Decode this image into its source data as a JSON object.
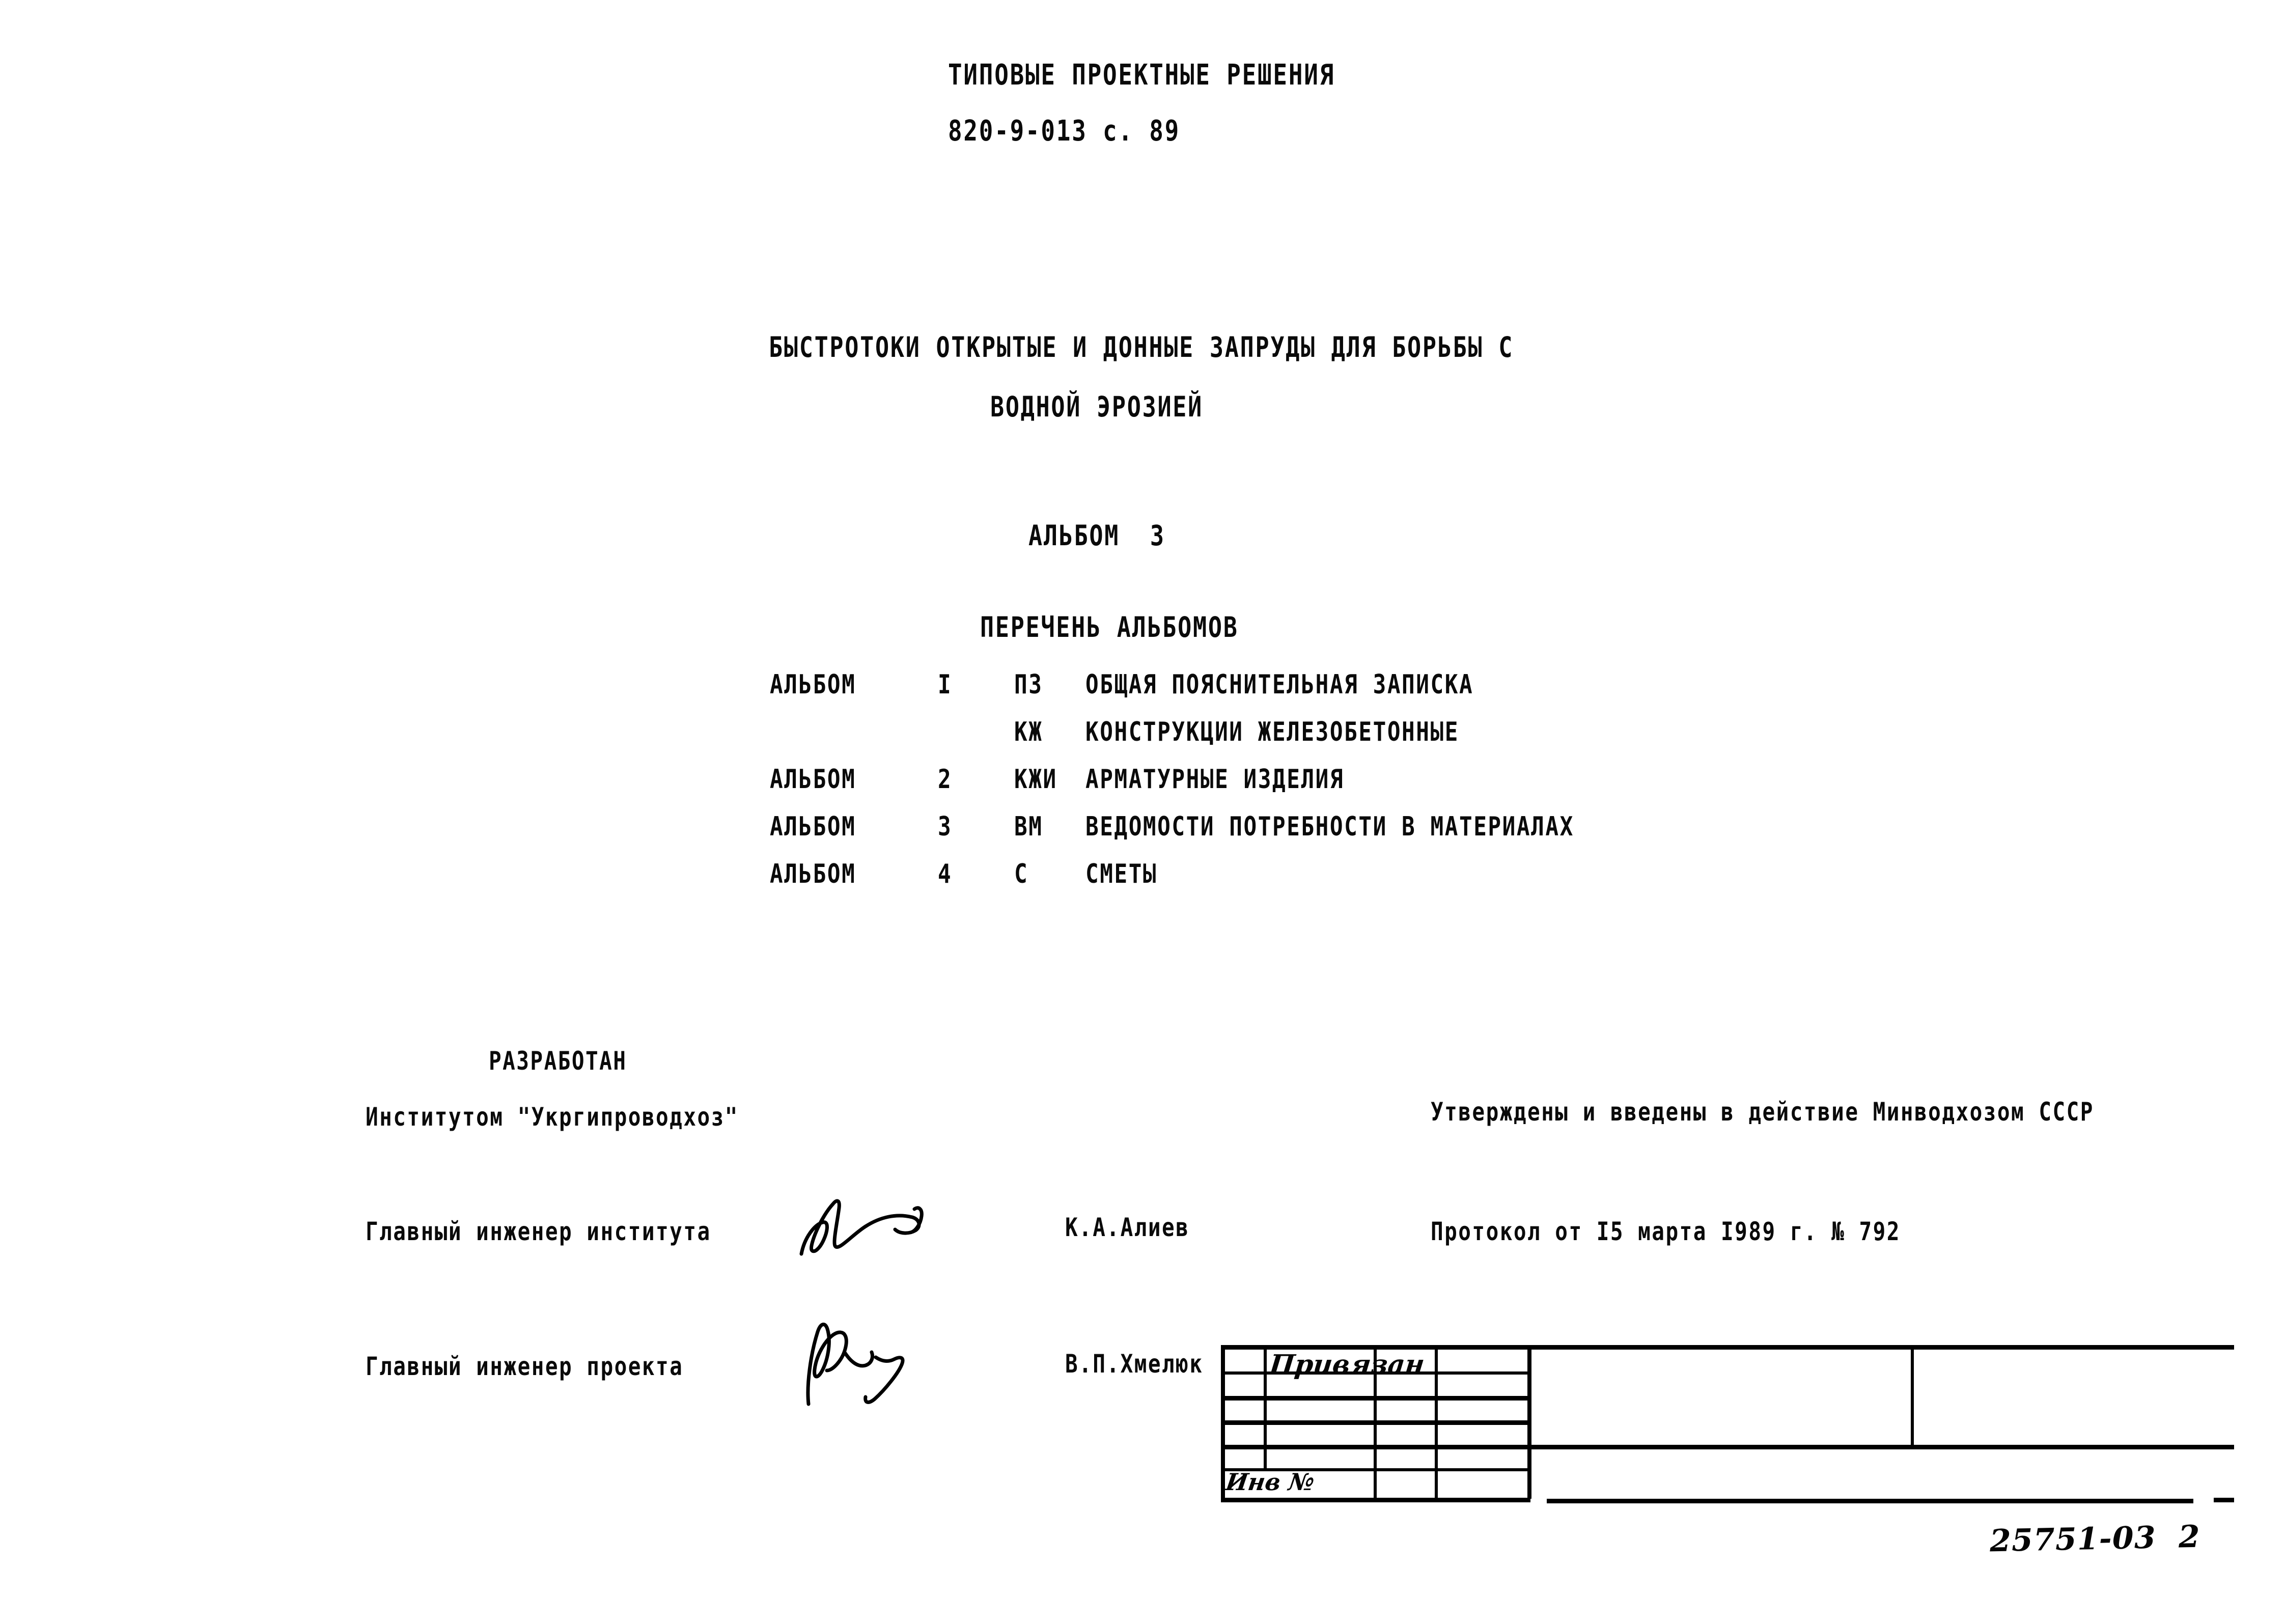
{
  "header": {
    "line1": "ТИПОВЫЕ ПРОЕКТНЫЕ РЕШЕНИЯ",
    "line2": "820-9-013 с. 89"
  },
  "title": {
    "line1": "БЫСТРОТОКИ ОТКРЫТЫЕ И ДОННЫЕ ЗАПРУДЫ ДЛЯ БОРЬБЫ С",
    "line2": "ВОДНОЙ ЭРОЗИЕЙ"
  },
  "album": {
    "current": "АЛЬБОМ  3",
    "list_heading": "ПЕРЕЧЕНЬ АЛЬБОМОВ",
    "rows": [
      {
        "album": "АЛЬБОМ",
        "number": "I",
        "code": "ПЗ",
        "name": "ОБЩАЯ ПОЯСНИТЕЛЬНАЯ ЗАПИСКА"
      },
      {
        "album": "",
        "number": "",
        "code": "КЖ",
        "name": "КОНСТРУКЦИИ ЖЕЛЕЗОБЕТОННЫЕ"
      },
      {
        "album": "АЛЬБОМ",
        "number": "2",
        "code": "КЖИ",
        "name": "АРМАТУРНЫЕ ИЗДЕЛИЯ"
      },
      {
        "album": "АЛЬБОМ",
        "number": "3",
        "code": "ВМ",
        "name": "ВЕДОМОСТИ ПОТРЕБНОСТИ В МАТЕРИАЛАХ"
      },
      {
        "album": "АЛЬБОМ",
        "number": "4",
        "code": "С",
        "name": "СМЕТЫ"
      }
    ]
  },
  "developed": {
    "label": "РАЗРАБОТАН",
    "organization": "Институтом \"Укргипроводхоз\""
  },
  "approval": {
    "text": "Утверждены и введены в действие Минводхозом СССР",
    "protocol": "Протокол от I5 марта I989 г. № 792"
  },
  "signatures": [
    {
      "title": "Главный инженер института",
      "name": "К.А.Алиев"
    },
    {
      "title": "Главный инженер проекта",
      "name": "В.П.Хмелюк"
    }
  ],
  "stamp": {
    "privyazan": "Привязан",
    "inv_label": "Инв №"
  },
  "doc_number": "25751-03  2"
}
